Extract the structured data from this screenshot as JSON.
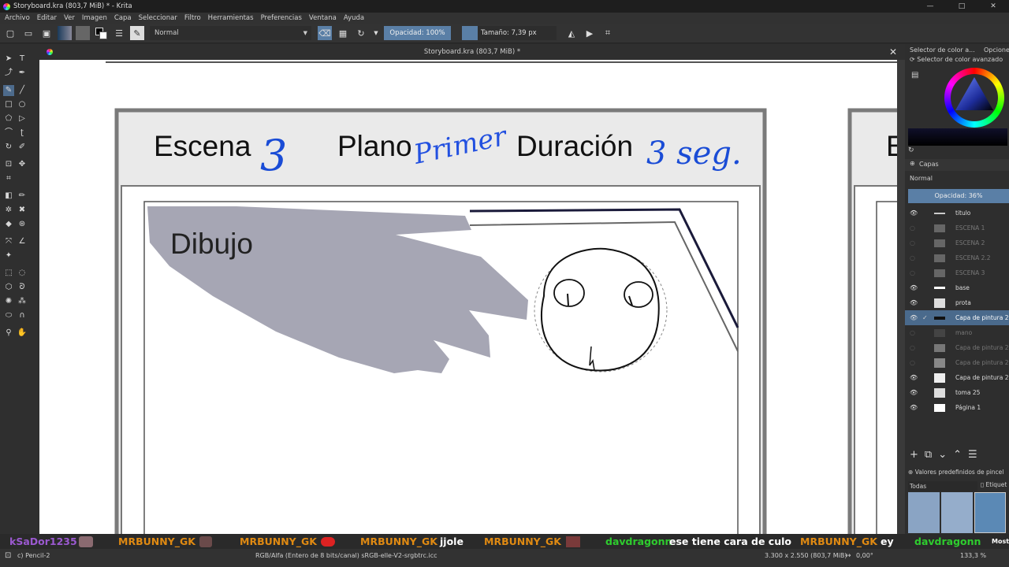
{
  "window": {
    "title": "Storyboard.kra (803,7 MiB) * - Krita",
    "minimize": "—",
    "maximize": "□",
    "close": "✕"
  },
  "menu": [
    "Archivo",
    "Editar",
    "Ver",
    "Imagen",
    "Capa",
    "Seleccionar",
    "Filtro",
    "Herramientas",
    "Preferencias",
    "Ventana",
    "Ayuda"
  ],
  "toolbar": {
    "blend_mode": "Normal",
    "opacity": "Opacidad: 100%",
    "size": "Tamaño: 7,39 px"
  },
  "document": {
    "tab_title": "Storyboard.kra (803,7 MiB) *",
    "close": "✕"
  },
  "storyboard": {
    "scene_label": "Escena",
    "scene_value": "3",
    "shot_label": "Plano",
    "shot_value": "Primer",
    "duration_label": "Duración",
    "duration_value": "3 seg.",
    "drawing_label": "Dibujo",
    "next_panel_label": "E"
  },
  "color_panel": {
    "tab1": "Selector de color a...",
    "tab2": "Opciones",
    "title": "Selector de color avanzado"
  },
  "layers_panel": {
    "title": "Capas",
    "blend": "Normal",
    "opacity": "Opacidad:  36%",
    "layers": [
      {
        "name": "titulo",
        "visible": true
      },
      {
        "name": "ESCENA 1",
        "visible": false
      },
      {
        "name": "ESCENA 2",
        "visible": false
      },
      {
        "name": "ESCENA 2.2",
        "visible": false
      },
      {
        "name": "ESCENA 3",
        "visible": false
      },
      {
        "name": "base",
        "visible": true
      },
      {
        "name": "prota",
        "visible": true
      },
      {
        "name": "Capa de pintura 29",
        "visible": true,
        "selected": true
      },
      {
        "name": "mano",
        "visible": false
      },
      {
        "name": "Capa de pintura 29",
        "visible": false
      },
      {
        "name": "Capa de pintura 29",
        "visible": false
      },
      {
        "name": "Capa de pintura 28",
        "visible": true
      },
      {
        "name": "toma 25",
        "visible": true
      },
      {
        "name": "Página 1",
        "visible": true
      }
    ]
  },
  "brush_panel": {
    "title": "Valores predefinidos de pincel",
    "filter": "Todas",
    "tag": "Etiquet"
  },
  "chat": [
    {
      "user": "kSaDor1235",
      "msg": "",
      "color": "#9b59d0"
    },
    {
      "user": "MRBUNNY_GK",
      "msg": "",
      "color": "#e08a12"
    },
    {
      "user": "MRBUNNY_GK",
      "msg": "",
      "color": "#e08a12"
    },
    {
      "user": "MRBUNNY_GK",
      "msg": "jjole",
      "color": "#e08a12"
    },
    {
      "user": "MRBUNNY_GK",
      "msg": "",
      "color": "#e08a12"
    },
    {
      "user": "davdragonn",
      "msg": "ese tiene cara de culo",
      "color": "#2ecc2e"
    },
    {
      "user": "MRBUNNY_GK",
      "msg": "ey",
      "color": "#e08a12"
    },
    {
      "user": "davdragonn",
      "msg": "",
      "color": "#2ecc2e"
    }
  ],
  "chat_extra": "Mostr",
  "status": {
    "brush": "c) Pencil-2",
    "colorspace": "RGB/Alfa (Entero de 8 bits/canal)  sRGB-elle-V2-srgbtrc.icc",
    "dims": "3.300 x 2.550 (803,7 MiB)",
    "rotation": "0,00°",
    "zoom": "133,3 %"
  }
}
